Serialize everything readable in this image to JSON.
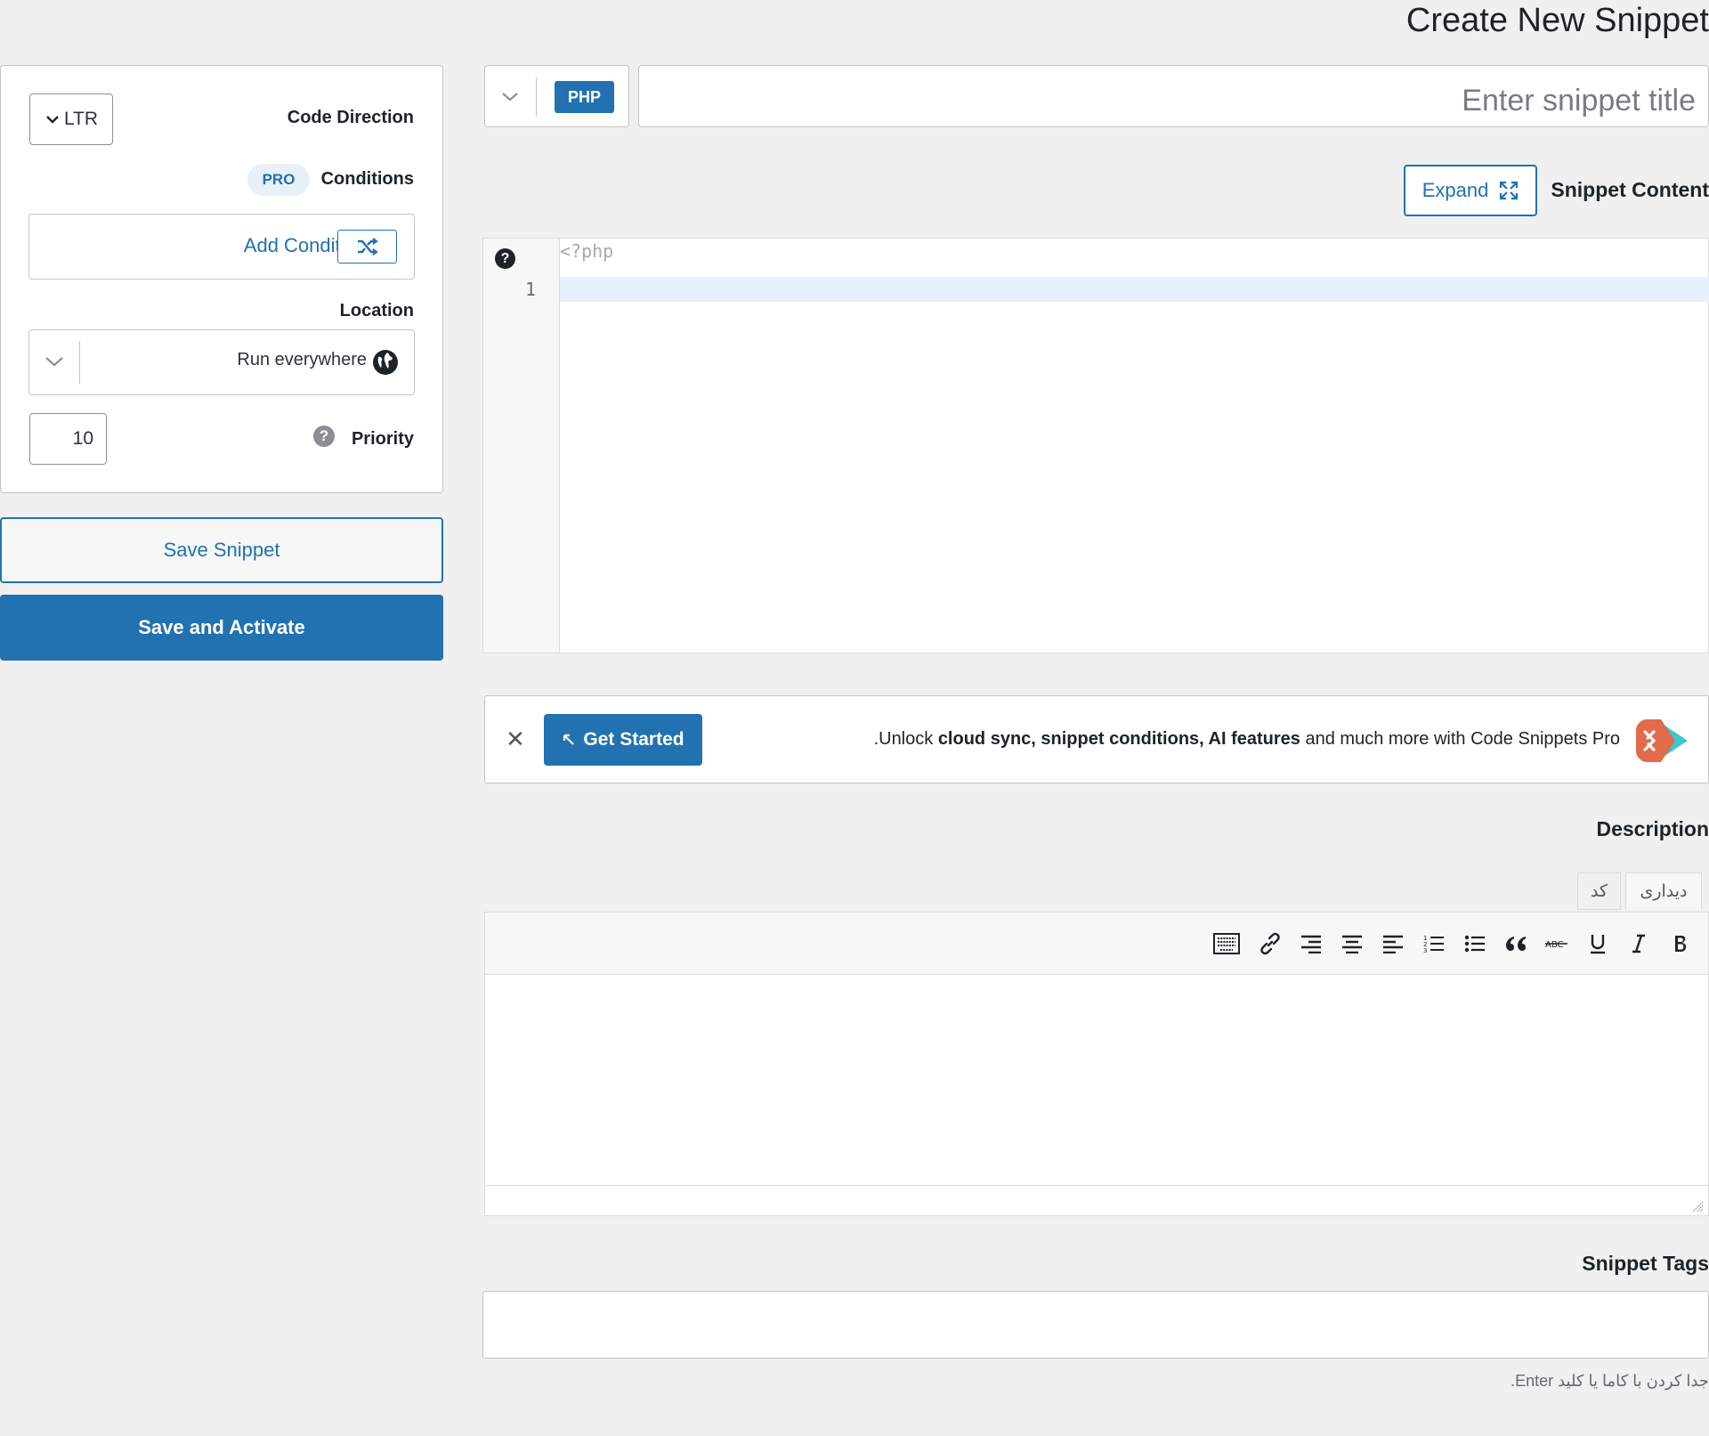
{
  "page": {
    "title": "Create New Snippet"
  },
  "sidebar": {
    "code_direction": {
      "label": "Code Direction",
      "value": "LTR"
    },
    "conditions": {
      "badge": "PRO",
      "label": "Conditions",
      "add_label": "Add Conditions"
    },
    "location": {
      "label": "Location",
      "value": "Run everywhere"
    },
    "priority": {
      "label": "Priority",
      "value": "10"
    },
    "save_label": "Save Snippet",
    "save_activate_label": "Save and Activate"
  },
  "main": {
    "language_badge": "PHP",
    "title_placeholder": "Enter snippet title",
    "content_label": "Snippet Content",
    "expand_label": "Expand",
    "code_editor": {
      "opening_tag": "<?php",
      "line_number": "1",
      "help_glyph": "?"
    }
  },
  "promo": {
    "close_glyph": "✕",
    "button_label": "Get Started",
    "text_prefix": ".Unlock ",
    "text_bold": "cloud sync, snippet conditions, AI features",
    "text_suffix": " and much more with Code Snippets Pro"
  },
  "description": {
    "label": "Description",
    "tabs": [
      "دیداری",
      "کد"
    ],
    "toolbar_icons": [
      "bold-icon",
      "italic-icon",
      "underline-icon",
      "strikethrough-icon",
      "blockquote-icon",
      "bulleted-list-icon",
      "numbered-list-icon",
      "align-left-icon",
      "align-center-icon",
      "align-right-icon",
      "link-icon",
      "keyboard-icon"
    ]
  },
  "tags": {
    "label": "Snippet Tags",
    "help": "جدا کردن با کاما یا کلید Enter."
  },
  "colors": {
    "accent": "#2271b1",
    "background": "#f0f0f1",
    "text": "#1d2327"
  }
}
